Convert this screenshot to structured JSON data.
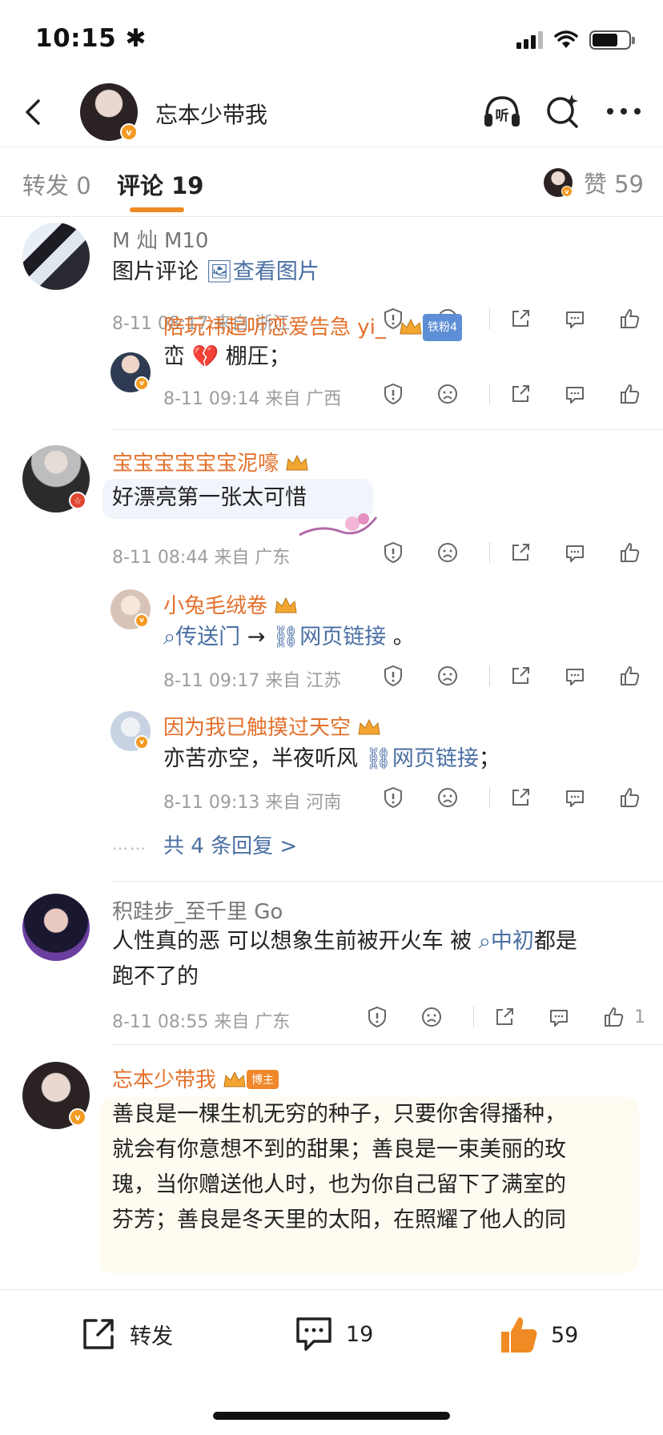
{
  "status_bar": {
    "time": "10:15 ✱"
  },
  "header": {
    "title": "忘本少带我"
  },
  "tabs": [
    {
      "label": "转发 0"
    },
    {
      "label": "评论 19"
    }
  ],
  "likes_tab": {
    "label": "赞 59"
  },
  "comments": [
    {
      "user": "M 灿 M10",
      "text_parts": [
        "图片评论 ",
        "🖼查看图片"
      ],
      "meta": "8-11 08:17  来自 浙江",
      "reply": {
        "user": "陪玩祎起听恋爱告急 yi_",
        "badge": "铁粉4",
        "text": "峦 💔 棚圧；",
        "meta": "8-11 09:14  来自 广西"
      }
    },
    {
      "user": "宝宝宝宝宝宝泥嚎",
      "text": "好漂亮第一张太可惜",
      "meta": "8-11 08:44  来自 广东",
      "replies": [
        {
          "user": "小兔毛绒卷",
          "text_parts": [
            "⌕传送门",
            " → ",
            "⛓网页链接",
            " 。"
          ],
          "meta": "8-11 09:17  来自 江苏"
        },
        {
          "user": "因为我已触摸过天空",
          "text_parts": [
            "亦苦亦空，半夜听风 ",
            "⛓网页链接",
            "；"
          ],
          "meta": "8-11 09:13  来自 河南"
        }
      ],
      "more_replies": "共 4 条回复 >",
      "dots": "……"
    },
    {
      "user": "积跬步_至千里 Go",
      "text_parts": [
        "人性真的恶 可以想象生前被开火车 被 ",
        "⌕中初",
        "都是"
      ],
      "text_line2": "跑不了的",
      "meta": "8-11 08:55  来自 广东",
      "like_count": "1"
    },
    {
      "user": "忘本少带我",
      "badge": "博主",
      "lines": [
        "善良是一棵生机无穷的种子，只要你舍得播种，",
        "就会有你意想不到的甜果；善良是一束美丽的玫",
        "瑰，当你赠送他人时，也为你自己留下了满室的",
        "芬芳；善良是冬天里的太阳，在照耀了他人的同"
      ]
    }
  ],
  "bottom_bar": {
    "repost_label": "转发",
    "comment_count": "19",
    "like_count": "59"
  },
  "colors": {
    "accent": "#f08a24",
    "username": "#e3702b",
    "link": "#4a6fa3"
  }
}
